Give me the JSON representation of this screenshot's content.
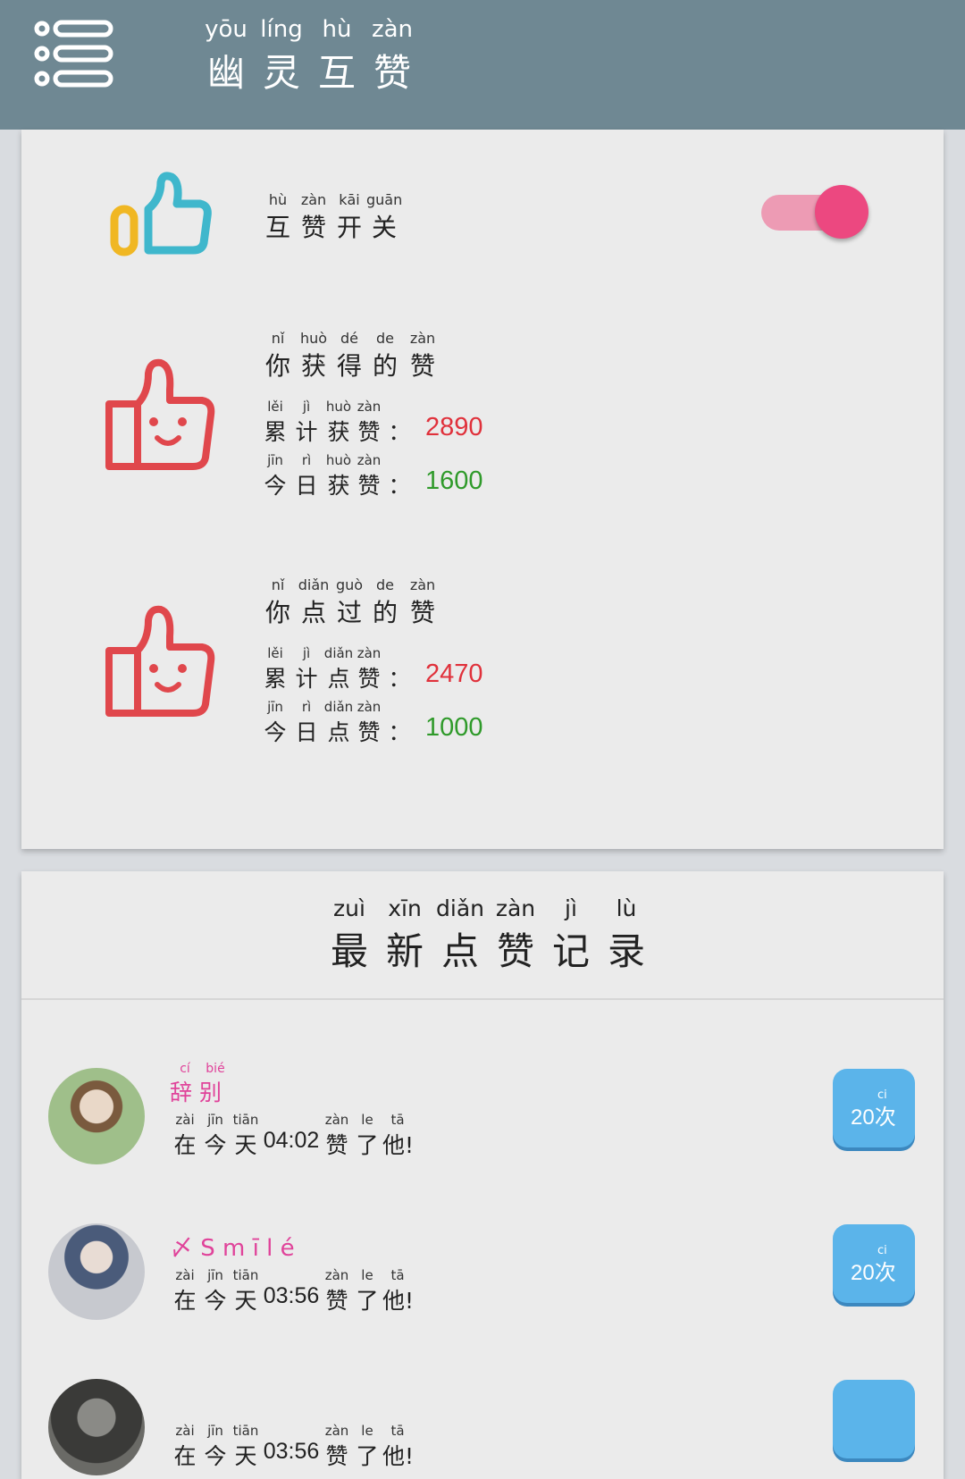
{
  "header": {
    "title_pinyin": [
      "yōu",
      "líng",
      "hù",
      "zàn"
    ],
    "title_chars": [
      "幽",
      "灵",
      "互",
      "赞"
    ]
  },
  "switch": {
    "pinyin": [
      "hù",
      "zàn",
      "kāi",
      "guān"
    ],
    "chars": [
      "互",
      "赞",
      "开",
      "关"
    ],
    "state": "on",
    "accent": "#ec4880"
  },
  "received": {
    "title_pinyin": [
      "nǐ",
      "huò",
      "dé",
      "de",
      "zàn"
    ],
    "title_chars": [
      "你",
      "获",
      "得",
      "的",
      "赞"
    ],
    "total_pinyin": [
      "lěi",
      "jì",
      "huò",
      "zàn"
    ],
    "total_chars": [
      "累",
      "计",
      "获",
      "赞",
      "："
    ],
    "total_value": "2890",
    "today_pinyin": [
      "jīn",
      "rì",
      "huò",
      "zàn"
    ],
    "today_chars": [
      "今",
      "日",
      "获",
      "赞",
      "："
    ],
    "today_value": "1600"
  },
  "given": {
    "title_pinyin": [
      "nǐ",
      "diǎn",
      "guò",
      "de",
      "zàn"
    ],
    "title_chars": [
      "你",
      "点",
      "过",
      "的",
      "赞"
    ],
    "total_pinyin": [
      "lěi",
      "jì",
      "diǎn",
      "zàn"
    ],
    "total_chars": [
      "累",
      "计",
      "点",
      "赞",
      "："
    ],
    "total_value": "2470",
    "today_pinyin": [
      "jīn",
      "rì",
      "diǎn",
      "zàn"
    ],
    "today_chars": [
      "今",
      "日",
      "点",
      "赞",
      "："
    ],
    "today_value": "1000"
  },
  "records": {
    "title_pinyin": [
      "zuì",
      "xīn",
      "diǎn",
      "zàn",
      "jì",
      "lù"
    ],
    "title_chars": [
      "最",
      "新",
      "点",
      "赞",
      "记",
      "录"
    ],
    "items": [
      {
        "name_pinyin": [
          "cí",
          "bié"
        ],
        "name": "辞 别",
        "line_pinyin": [
          "zài",
          "jīn",
          "tiān",
          "",
          "zàn",
          "le",
          "tā"
        ],
        "line": [
          "在",
          "今",
          "天",
          "04:02",
          "赞",
          "了",
          "他!"
        ],
        "badge_ci": "ci",
        "badge": "20次"
      },
      {
        "name_pinyin": [],
        "name": "〆 S m ī l é",
        "line_pinyin": [
          "zài",
          "jīn",
          "tiān",
          "",
          "zàn",
          "le",
          "tā"
        ],
        "line": [
          "在",
          "今",
          "天",
          "03:56",
          "赞",
          "了",
          "他!"
        ],
        "badge_ci": "ci",
        "badge": "20次"
      },
      {
        "name_pinyin": [],
        "name": "",
        "line_pinyin": [
          "zài",
          "jīn",
          "tiān",
          "",
          "zàn",
          "le",
          "tā"
        ],
        "line": [
          "在",
          "今",
          "天",
          "03:56",
          "赞",
          "了",
          "他!"
        ],
        "badge_ci": "",
        "badge": ""
      }
    ]
  },
  "colors": {
    "header_bg": "#6f8893",
    "count_red": "#e0313b",
    "count_green": "#2f9a2a",
    "name_pink": "#e0439a",
    "badge_blue": "#5bb4ea"
  }
}
